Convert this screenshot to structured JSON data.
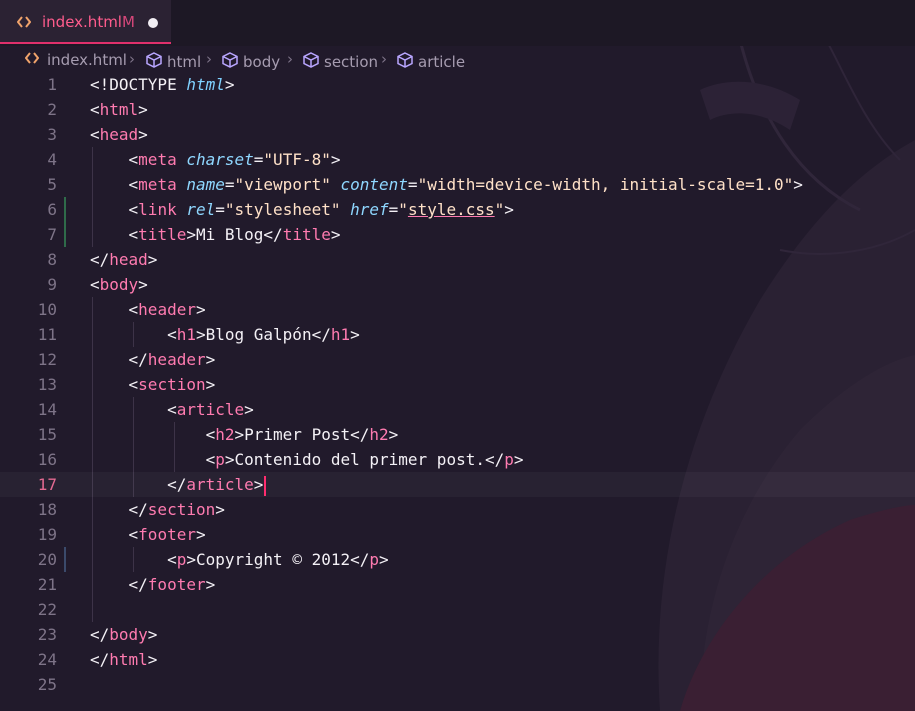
{
  "tab": {
    "filename": "index.html",
    "status": "M"
  },
  "breadcrumb": [
    "index.html",
    "html",
    "body",
    "section",
    "article"
  ],
  "lines": [
    {
      "n": "1"
    },
    {
      "n": "2"
    },
    {
      "n": "3"
    },
    {
      "n": "4"
    },
    {
      "n": "5"
    },
    {
      "n": "6"
    },
    {
      "n": "7"
    },
    {
      "n": "8"
    },
    {
      "n": "9"
    },
    {
      "n": "10"
    },
    {
      "n": "11"
    },
    {
      "n": "12"
    },
    {
      "n": "13"
    },
    {
      "n": "14"
    },
    {
      "n": "15"
    },
    {
      "n": "16"
    },
    {
      "n": "17"
    },
    {
      "n": "18"
    },
    {
      "n": "19"
    },
    {
      "n": "20"
    },
    {
      "n": "21"
    },
    {
      "n": "22"
    },
    {
      "n": "23"
    },
    {
      "n": "24"
    },
    {
      "n": "25"
    }
  ],
  "code": {
    "doctype_kw": "<!DOCTYPE",
    "doctype_val": "html",
    "html_tag": "html",
    "head_tag": "head",
    "meta_tag": "meta",
    "charset_attr": "charset",
    "charset_val": "\"UTF-8\"",
    "name_attr": "name",
    "name_val": "\"viewport\"",
    "content_attr": "content",
    "content_val": "\"width=device-width, initial-scale=1.0\"",
    "link_tag": "link",
    "rel_attr": "rel",
    "rel_val": "\"stylesheet\"",
    "href_attr": "href",
    "href_q": "\"",
    "href_val": "style.css",
    "title_tag": "title",
    "title_text": "Mi Blog",
    "body_tag": "body",
    "header_tag": "header",
    "h1_tag": "h1",
    "h1_text": "Blog Galpón",
    "section_tag": "section",
    "article_tag": "article",
    "h2_tag": "h2",
    "h2_text": "Primer Post",
    "p_tag": "p",
    "p_text": "Contenido del primer post.",
    "footer_tag": "footer",
    "footer_text": "Copyright © 2012"
  },
  "active_line": "17",
  "colors": {
    "accent": "#e0306c",
    "tag": "#ff7bb0",
    "attribute": "#8fd7ff",
    "string": "#ffe1c8",
    "background": "#211a2b"
  },
  "icons": {
    "file_icon": "code-brackets-icon",
    "crumb_icon": "cube-icon"
  }
}
